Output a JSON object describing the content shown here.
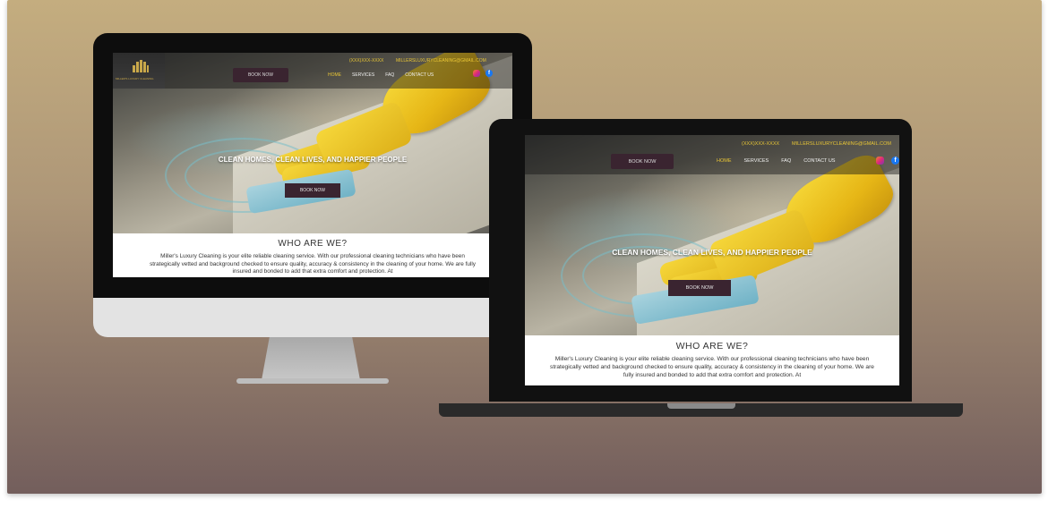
{
  "colors": {
    "background_top": "#c4ad7f",
    "background_bottom": "#735e5c",
    "accent_gold": "#e9c636",
    "button_plum": "#3a2430"
  },
  "website": {
    "phone": "(XXX)XXX-XXXX",
    "email": "MILLERSLUXURYCLEANING@GMAIL.COM",
    "logo_text": "MILLER'S LUXURY CLEANING",
    "top_book_button": "BOOK NOW",
    "nav": [
      "HOME",
      "SERVICES",
      "FAQ",
      "CONTACT US"
    ],
    "active_nav": "HOME",
    "social_icons": [
      "instagram-icon",
      "facebook-icon"
    ],
    "hero_tagline": "CLEAN HOMES, CLEAN LIVES, AND HAPPIER PEOPLE",
    "hero_book_button": "BOOK NOW",
    "about_heading": "WHO ARE WE?",
    "about_text": "Miller's Luxury Cleaning is your elite reliable cleaning service. With our professional cleaning technicians who have been strategically vetted and background checked to ensure quality, accuracy & consistency in the cleaning of your home. We are fully insured and bonded to add that extra comfort and protection. At"
  }
}
